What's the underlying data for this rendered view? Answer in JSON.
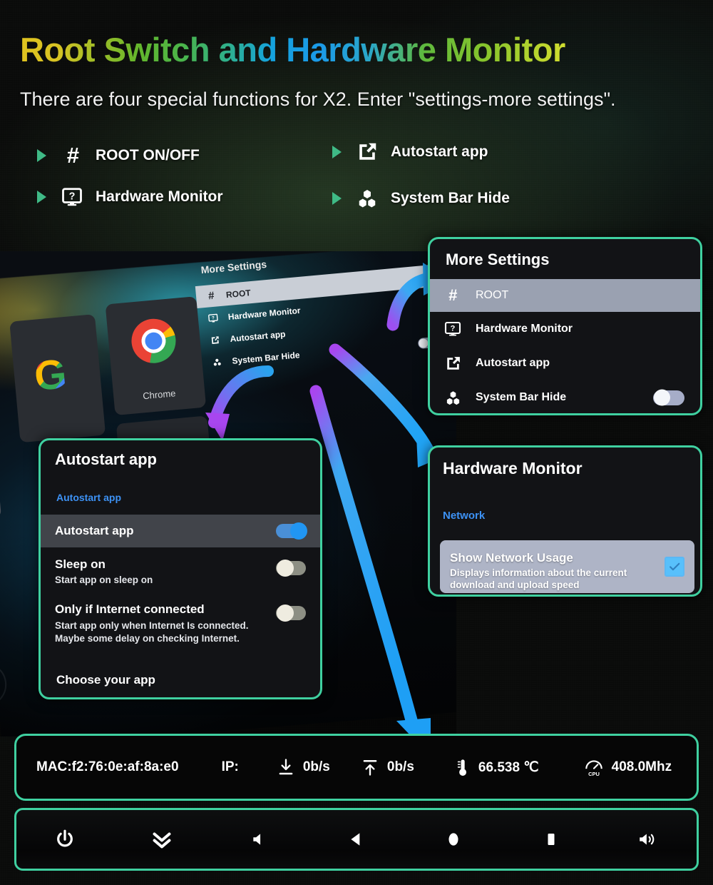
{
  "header": {
    "title": "Root Switch and Hardware Monitor",
    "subtitle": "There are four special functions for X2.  Enter \"settings-more settings\"."
  },
  "features": [
    {
      "icon": "hash-icon",
      "label": "ROOT ON/OFF"
    },
    {
      "icon": "monitor-help-icon",
      "label": "Hardware Monitor"
    },
    {
      "icon": "external-link-icon",
      "label": "Autostart app"
    },
    {
      "icon": "hexagons-icon",
      "label": "System Bar Hide"
    }
  ],
  "more_settings_card": {
    "title": "More Settings",
    "items": [
      {
        "icon": "hash-icon",
        "label": "ROOT",
        "selected": true,
        "toggle": null
      },
      {
        "icon": "monitor-help-icon",
        "label": "Hardware Monitor",
        "selected": false,
        "toggle": null
      },
      {
        "icon": "external-link-icon",
        "label": "Autostart app",
        "selected": false,
        "toggle": null
      },
      {
        "icon": "hexagons-icon",
        "label": "System Bar Hide",
        "selected": false,
        "toggle": "off"
      }
    ]
  },
  "hardware_monitor_card": {
    "title": "Hardware Monitor",
    "section_label": "Network",
    "item_title": "Show Network Usage",
    "item_desc": "Displays information about the current download and upload speed",
    "checkbox": "checked"
  },
  "autostart_card": {
    "title": "Autostart app",
    "section_label": "Autostart app",
    "rows": [
      {
        "label": "Autostart app",
        "desc": "",
        "toggle": "on",
        "selected": true
      },
      {
        "label": "Sleep on",
        "desc": "Start app on sleep on",
        "toggle": "off",
        "selected": false
      },
      {
        "label": "Only if Internet connected",
        "desc": "Start app only when Internet Is connected.\nMaybe some delay on checking Internet.",
        "toggle": "off",
        "selected": false
      }
    ],
    "footer_label": "Choose your app"
  },
  "status_bar": {
    "mac": "MAC:f2:76:0e:af:8a:e0",
    "ip_label": "IP:",
    "download_icon": "download-icon",
    "download_speed": "0b/s",
    "upload_icon": "upload-icon",
    "upload_speed": "0b/s",
    "temp_icon": "thermometer-icon",
    "temperature": "66.538 ℃",
    "cpu_icon": "cpu-gauge-icon",
    "cpu_freq": "408.0Mhz"
  },
  "nav_bar": {
    "buttons": [
      {
        "icon": "power-icon",
        "label": "Power"
      },
      {
        "icon": "double-chevron-down-icon",
        "label": "Collapse"
      },
      {
        "icon": "volume-down-icon",
        "label": "Volume Down"
      },
      {
        "icon": "back-icon",
        "label": "Back"
      },
      {
        "icon": "home-icon",
        "label": "Home"
      },
      {
        "icon": "recents-icon",
        "label": "Recents"
      },
      {
        "icon": "volume-up-icon",
        "label": "Volume Up"
      }
    ]
  },
  "background_device": {
    "menu_title": "More Settings",
    "menu_items": [
      {
        "label": "ROOT",
        "selected": true
      },
      {
        "label": "Hardware Monitor",
        "selected": false
      },
      {
        "label": "Autostart app",
        "selected": false
      },
      {
        "label": "System Bar Hide",
        "selected": false
      }
    ],
    "app_tiles": [
      {
        "label": "",
        "icon": "google-logo"
      },
      {
        "label": "Chrome",
        "icon": "chrome-logo"
      }
    ]
  },
  "colors": {
    "card_border": "#3fd0a0",
    "accent_blue": "#3d92f5",
    "bullet_green": "#3fba86",
    "arrow_blue": "#2aa3ef",
    "arrow_purple": "#9d4ff0"
  }
}
